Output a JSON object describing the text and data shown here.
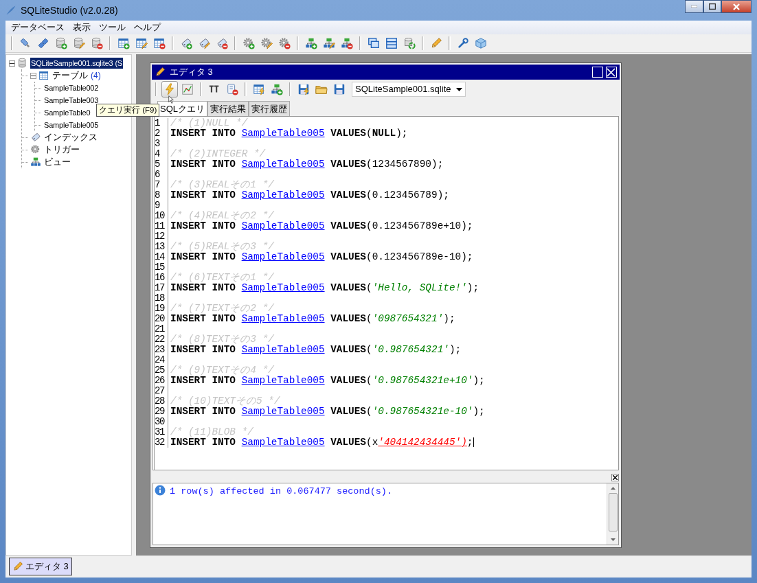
{
  "window": {
    "title": "SQLiteStudio (v2.0.28)"
  },
  "menu": [
    "データベース",
    "表示",
    "ツール",
    "ヘルプ"
  ],
  "tree": {
    "items": [
      {
        "kind": "database",
        "label": "SQLiteSample001.sqlite3 (S",
        "selected": true,
        "expanded": true,
        "children": [
          {
            "kind": "tables",
            "label": "テーブル",
            "count": "(4)",
            "selected": false,
            "expanded": true,
            "children": [
              {
                "label": "SampleTable002",
                "selected": false
              },
              {
                "label": "SampleTable003",
                "selected": false
              },
              {
                "label": "SampleTable0",
                "selected": false
              },
              {
                "label": "SampleTable005",
                "selected": false
              }
            ]
          },
          {
            "kind": "indexes",
            "label": "インデックス",
            "selected": false
          },
          {
            "kind": "triggers",
            "label": "トリガー",
            "selected": false
          },
          {
            "kind": "views",
            "label": "ビュー",
            "selected": false
          }
        ]
      }
    ]
  },
  "editor": {
    "title": "エディタ 3",
    "database_select": {
      "value": "SQLiteSample001.sqlite"
    },
    "tabs": [
      {
        "label": "SQLクエリ",
        "selected": true
      },
      {
        "label": "実行結果",
        "selected": false
      },
      {
        "label": "実行履歴",
        "selected": false
      }
    ],
    "lines": [
      {
        "number": "1",
        "tokens": [
          {
            "kind": "comment",
            "text": "/* (1)NULL */"
          }
        ]
      },
      {
        "number": "2",
        "tokens": [
          {
            "kind": "keyword",
            "text": "INSERT INTO "
          },
          {
            "kind": "table",
            "text": "SampleTable005"
          },
          {
            "kind": "keyword",
            "text": " VALUES"
          },
          {
            "kind": "plain",
            "text": "("
          },
          {
            "kind": "keyword",
            "text": "NULL"
          },
          {
            "kind": "plain",
            "text": ");"
          }
        ]
      },
      {
        "number": "3"
      },
      {
        "number": "4",
        "tokens": [
          {
            "kind": "comment",
            "text": "/* (2)INTEGER */"
          }
        ]
      },
      {
        "number": "5",
        "tokens": [
          {
            "kind": "keyword",
            "text": "INSERT INTO "
          },
          {
            "kind": "table",
            "text": "SampleTable005"
          },
          {
            "kind": "keyword",
            "text": " VALUES"
          },
          {
            "kind": "plain",
            "text": "(1234567890);"
          }
        ]
      },
      {
        "number": "6"
      },
      {
        "number": "7",
        "tokens": [
          {
            "kind": "comment",
            "text": "/* (3)REALその1 */"
          }
        ]
      },
      {
        "number": "8",
        "tokens": [
          {
            "kind": "keyword",
            "text": "INSERT INTO "
          },
          {
            "kind": "table",
            "text": "SampleTable005"
          },
          {
            "kind": "keyword",
            "text": " VALUES"
          },
          {
            "kind": "plain",
            "text": "(0.123456789);"
          }
        ]
      },
      {
        "number": "9"
      },
      {
        "number": "10",
        "tokens": [
          {
            "kind": "comment",
            "text": "/* (4)REALその2 */"
          }
        ]
      },
      {
        "number": "11",
        "tokens": [
          {
            "kind": "keyword",
            "text": "INSERT INTO "
          },
          {
            "kind": "table",
            "text": "SampleTable005"
          },
          {
            "kind": "keyword",
            "text": " VALUES"
          },
          {
            "kind": "plain",
            "text": "(0.123456789e+10);"
          }
        ]
      },
      {
        "number": "12"
      },
      {
        "number": "13",
        "tokens": [
          {
            "kind": "comment",
            "text": "/* (5)REALその3 */"
          }
        ]
      },
      {
        "number": "14",
        "tokens": [
          {
            "kind": "keyword",
            "text": "INSERT INTO "
          },
          {
            "kind": "table",
            "text": "SampleTable005"
          },
          {
            "kind": "keyword",
            "text": " VALUES"
          },
          {
            "kind": "plain",
            "text": "(0.123456789e-10);"
          }
        ]
      },
      {
        "number": "15"
      },
      {
        "number": "16",
        "tokens": [
          {
            "kind": "comment",
            "text": "/* (6)TEXTその1 */"
          }
        ]
      },
      {
        "number": "17",
        "tokens": [
          {
            "kind": "keyword",
            "text": "INSERT INTO "
          },
          {
            "kind": "table",
            "text": "SampleTable005"
          },
          {
            "kind": "keyword",
            "text": " VALUES"
          },
          {
            "kind": "plain",
            "text": "("
          },
          {
            "kind": "string",
            "text": "'Hello, SQLite!'"
          },
          {
            "kind": "plain",
            "text": ");"
          }
        ]
      },
      {
        "number": "18"
      },
      {
        "number": "19",
        "tokens": [
          {
            "kind": "comment",
            "text": "/* (7)TEXTその2 */"
          }
        ]
      },
      {
        "number": "20",
        "tokens": [
          {
            "kind": "keyword",
            "text": "INSERT INTO "
          },
          {
            "kind": "table",
            "text": "SampleTable005"
          },
          {
            "kind": "keyword",
            "text": " VALUES"
          },
          {
            "kind": "plain",
            "text": "("
          },
          {
            "kind": "string",
            "text": "'0987654321'"
          },
          {
            "kind": "plain",
            "text": ");"
          }
        ]
      },
      {
        "number": "21"
      },
      {
        "number": "22",
        "tokens": [
          {
            "kind": "comment",
            "text": "/* (8)TEXTその3 */"
          }
        ]
      },
      {
        "number": "23",
        "tokens": [
          {
            "kind": "keyword",
            "text": "INSERT INTO "
          },
          {
            "kind": "table",
            "text": "SampleTable005"
          },
          {
            "kind": "keyword",
            "text": " VALUES"
          },
          {
            "kind": "plain",
            "text": "("
          },
          {
            "kind": "string",
            "text": "'0.987654321'"
          },
          {
            "kind": "plain",
            "text": ");"
          }
        ]
      },
      {
        "number": "24"
      },
      {
        "number": "25",
        "tokens": [
          {
            "kind": "comment",
            "text": "/* (9)TEXTその4 */"
          }
        ]
      },
      {
        "number": "26",
        "tokens": [
          {
            "kind": "keyword",
            "text": "INSERT INTO "
          },
          {
            "kind": "table",
            "text": "SampleTable005"
          },
          {
            "kind": "keyword",
            "text": " VALUES"
          },
          {
            "kind": "plain",
            "text": "("
          },
          {
            "kind": "string",
            "text": "'0.987654321e+10'"
          },
          {
            "kind": "plain",
            "text": ");"
          }
        ]
      },
      {
        "number": "27"
      },
      {
        "number": "28",
        "tokens": [
          {
            "kind": "comment",
            "text": "/* (10)TEXTその5 */"
          }
        ]
      },
      {
        "number": "29",
        "tokens": [
          {
            "kind": "keyword",
            "text": "INSERT INTO "
          },
          {
            "kind": "table",
            "text": "SampleTable005"
          },
          {
            "kind": "keyword",
            "text": " VALUES"
          },
          {
            "kind": "plain",
            "text": "("
          },
          {
            "kind": "string",
            "text": "'0.987654321e-10'"
          },
          {
            "kind": "plain",
            "text": ");"
          }
        ]
      },
      {
        "number": "30"
      },
      {
        "number": "31",
        "tokens": [
          {
            "kind": "comment",
            "text": "/* (11)BLOB */"
          }
        ]
      },
      {
        "number": "32",
        "cursor": true,
        "tokens": [
          {
            "kind": "keyword",
            "text": "INSERT INTO "
          },
          {
            "kind": "table",
            "text": "SampleTable005"
          },
          {
            "kind": "keyword",
            "text": " VALUES"
          },
          {
            "kind": "plain",
            "text": "(x"
          },
          {
            "kind": "blob",
            "text": "'404142434445')"
          },
          {
            "kind": "plain",
            "text": ";"
          }
        ]
      }
    ],
    "message": "1 row(s) affected in 0.067477 second(s)."
  },
  "tooltip": "クエリ実行 (F9)",
  "taskbar": [
    {
      "label": "エディタ 3",
      "selected": true
    }
  ]
}
